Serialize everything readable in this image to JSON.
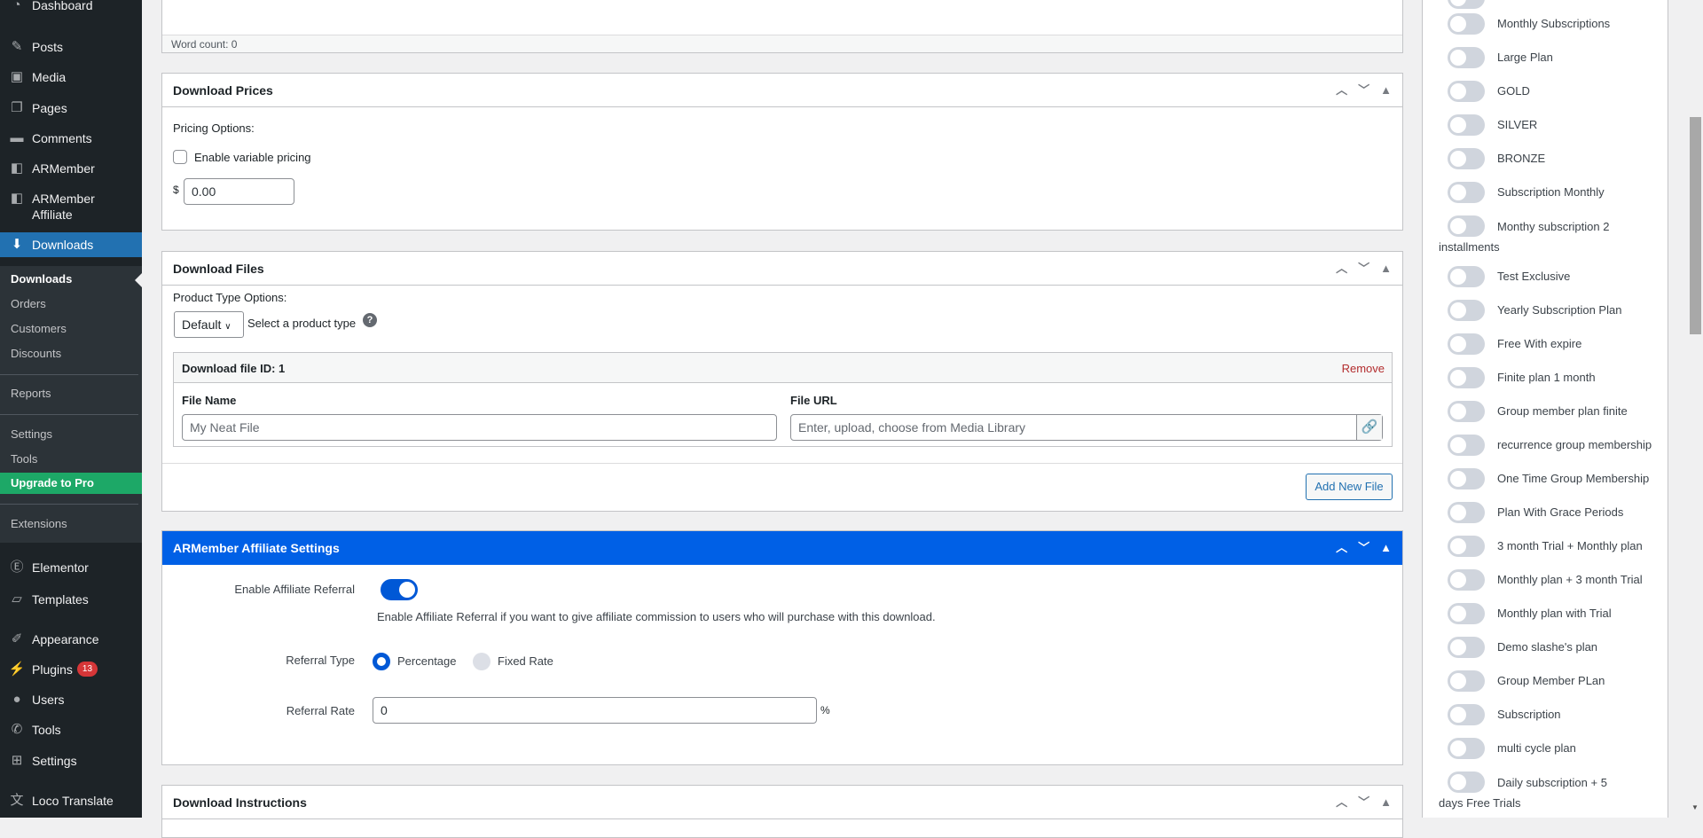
{
  "sidebar": {
    "menu": [
      {
        "label": "Dashboard",
        "icon": "dashboard-icon",
        "glyph": "◔"
      },
      {
        "label": "Posts",
        "icon": "pin-icon",
        "glyph": "✎"
      },
      {
        "label": "Media",
        "icon": "media-icon",
        "glyph": "▣"
      },
      {
        "label": "Pages",
        "icon": "pages-icon",
        "glyph": "❐"
      },
      {
        "label": "Comments",
        "icon": "comment-icon",
        "glyph": "▬"
      },
      {
        "label": "ARMember",
        "icon": "armember-icon",
        "glyph": "◧"
      },
      {
        "label": "ARMember Affiliate",
        "icon": "armember-affiliate-icon",
        "glyph": "◧"
      },
      {
        "label": "Downloads",
        "icon": "download-icon",
        "glyph": "⬇"
      },
      {
        "label": "Elementor",
        "icon": "elementor-icon",
        "glyph": "Ⓔ"
      },
      {
        "label": "Templates",
        "icon": "folder-icon",
        "glyph": "▱"
      },
      {
        "label": "Appearance",
        "icon": "brush-icon",
        "glyph": "✐"
      },
      {
        "label": "Plugins",
        "icon": "plug-icon",
        "glyph": "⚡"
      },
      {
        "label": "Users",
        "icon": "user-icon",
        "glyph": "●"
      },
      {
        "label": "Tools",
        "icon": "wrench-icon",
        "glyph": "✆"
      },
      {
        "label": "Settings",
        "icon": "settings-icon",
        "glyph": "⊞"
      },
      {
        "label": "Loco Translate",
        "icon": "translate-icon",
        "glyph": "文"
      }
    ],
    "plugins_badge": "13",
    "submenu": [
      "Downloads",
      "Orders",
      "Customers",
      "Discounts",
      "Reports",
      "Settings",
      "Tools",
      "Upgrade to Pro",
      "Extensions"
    ]
  },
  "editor": {
    "word_count": "Word count: 0"
  },
  "prices": {
    "title": "Download Prices",
    "pricing_options": "Pricing Options:",
    "variable_pricing": "Enable variable pricing",
    "currency": "$",
    "price": "0.00"
  },
  "files": {
    "title": "Download Files",
    "product_type_label": "Product Type Options:",
    "product_type_value": "Default",
    "product_type_hint": "Select a product type",
    "file_id": "Download file ID: 1",
    "remove": "Remove",
    "file_name_label": "File Name",
    "file_name_placeholder": "My Neat File",
    "file_url_label": "File URL",
    "file_url_placeholder": "Enter, upload, choose from Media Library",
    "add_new": "Add New File"
  },
  "affiliate": {
    "title": "ARMember Affiliate Settings",
    "enable_label": "Enable Affiliate Referral",
    "enable_desc": "Enable Affiliate Referral if you want to give affiliate commission to users who will purchase with this download.",
    "type_label": "Referral Type",
    "type_options": [
      "Percentage",
      "Fixed Rate"
    ],
    "rate_label": "Referral Rate",
    "rate_value": "0",
    "rate_unit": "%"
  },
  "instructions": {
    "title": "Download Instructions"
  },
  "plans": [
    "Monthly Subscriptions",
    "Large Plan",
    "GOLD",
    "SILVER",
    "BRONZE",
    "Subscription Monthly",
    "Monthy subscription 2 installments",
    "Test Exclusive",
    "Yearly Subscription Plan",
    "Free With expire",
    "Finite plan 1 month",
    "Group member plan finite",
    "recurrence group membership",
    "One Time Group Membership",
    "Plan With Grace Periods",
    "3 month Trial + Monthly plan",
    "Monthly plan + 3 month Trial",
    "Monthly plan with Trial",
    "Demo slashe's plan",
    "Group Member PLan",
    "Subscription",
    "multi cycle plan",
    "Daily subscription + 5 days Free Trials"
  ]
}
